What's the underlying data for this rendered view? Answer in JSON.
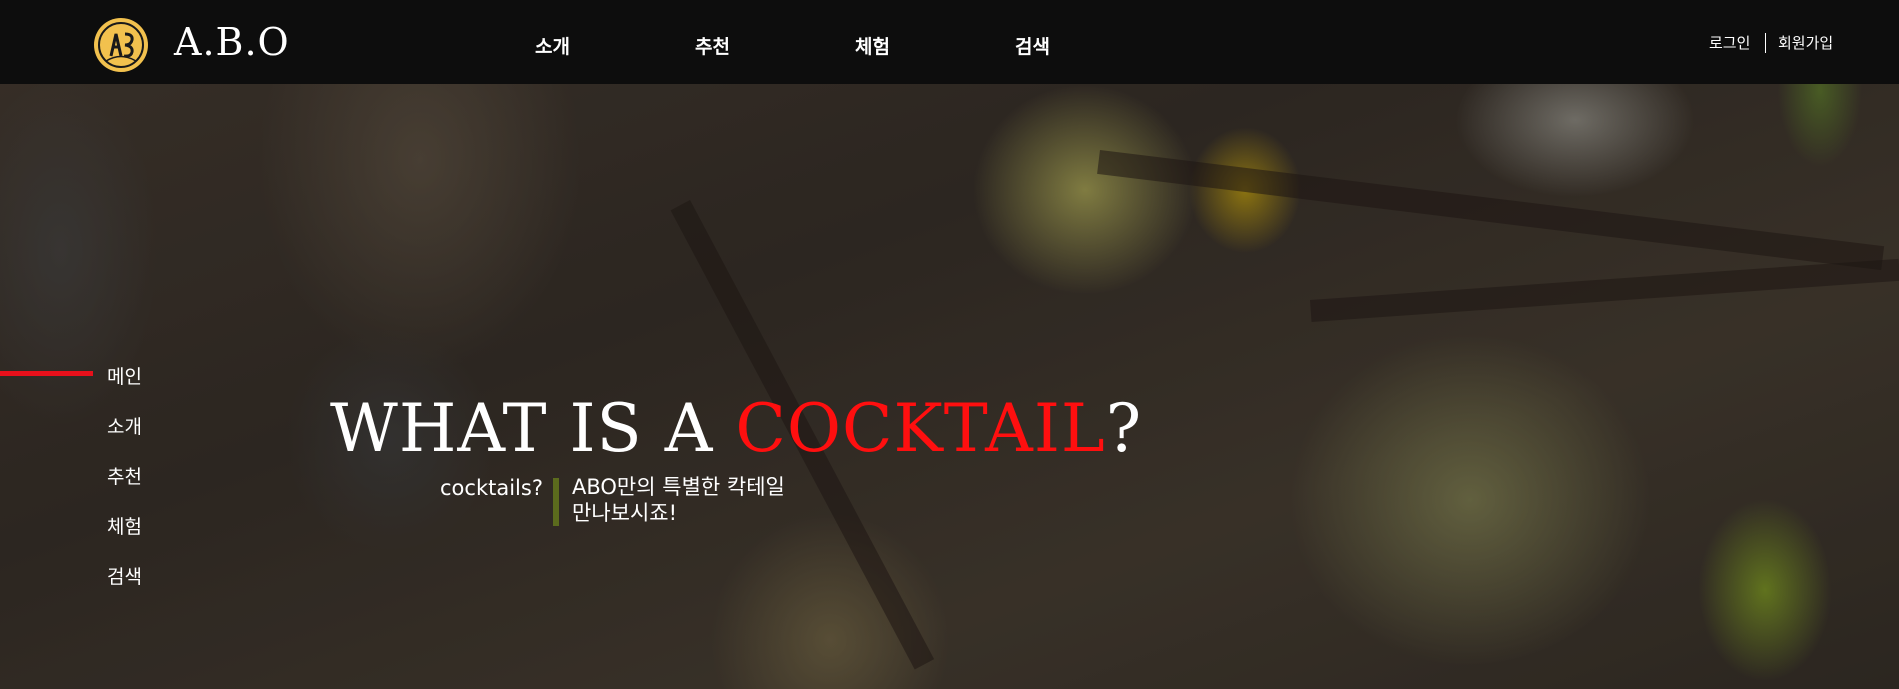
{
  "header": {
    "brand": "A.B.O",
    "logo_icon": "abo-cocktail-logo-icon",
    "nav": [
      "소개",
      "추천",
      "체험",
      "검색"
    ],
    "login": "로그인",
    "signup": "회원가입"
  },
  "side_nav": {
    "items": [
      "메인",
      "소개",
      "추천",
      "체험",
      "검색"
    ],
    "active": "메인"
  },
  "hero": {
    "headline_prefix": "WHAT IS A ",
    "headline_accent": "COCKTAIL",
    "headline_suffix": "?",
    "sub_left": "cocktails?",
    "sub_right_line1": "ABO만의 특별한 칵테일",
    "sub_right_line2": "만나보시죠!"
  },
  "colors": {
    "accent_red": "#ff0f0f",
    "active_line": "#e8101b",
    "divider_olive": "#5b6b1d",
    "logo_gold": "#f2c14e",
    "header_bg": "#0d0d0d"
  }
}
